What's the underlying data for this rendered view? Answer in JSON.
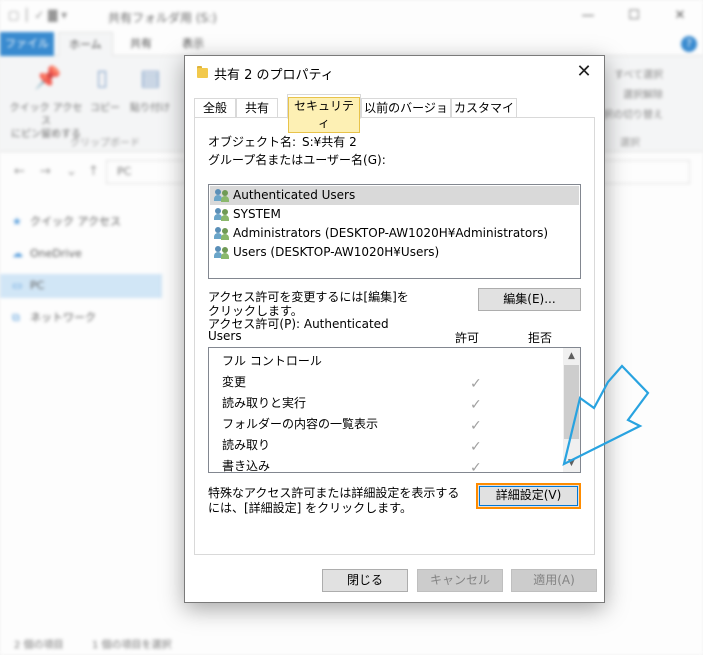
{
  "background": {
    "window_title": "共有フォルダ用 (S:)",
    "ribbon_tabs": [
      "ファイル",
      "ホーム",
      "共有",
      "表示"
    ],
    "ribbon_items": [
      "クイック アクセス\nにピン留めする",
      "コピー",
      "貼り付け"
    ],
    "ribbon_group_label": "クリップボード",
    "ribbon_right_items": [
      "すべて選択",
      "選択解除",
      "選択の切り替え"
    ],
    "ribbon_right_group": "選択",
    "address_path": "PC",
    "nav_items": [
      "クイック アクセス",
      "OneDrive",
      "PC",
      "ネットワーク"
    ],
    "status_left": "2 個の項目",
    "status_mid": "1 個の項目を選択"
  },
  "dialog": {
    "title": "共有 2 のプロパティ",
    "tabs": [
      "全般",
      "共有",
      "セキュリティ",
      "以前のバージョン",
      "カスタマイズ"
    ],
    "object_name_label": "オブジェクト名:",
    "object_name_value": "S:¥共有 2",
    "group_label": "グループ名またはユーザー名(G):",
    "users": [
      "Authenticated Users",
      "SYSTEM",
      "Administrators (DESKTOP-AW1020H¥Administrators)",
      "Users (DESKTOP-AW1020H¥Users)"
    ],
    "change_hint_line1": "アクセス許可を変更するには[編集]を",
    "change_hint_line2": "クリックします。",
    "edit_button": "編集(E)...",
    "perm_label_line1": "アクセス許可(P): Authenticated",
    "perm_label_line2": "Users",
    "allow_header": "許可",
    "deny_header": "拒否",
    "permissions": [
      "フル コントロール",
      "変更",
      "読み取りと実行",
      "フォルダーの内容の一覧表示",
      "読み取り",
      "書き込み"
    ],
    "advanced_hint_line1": "特殊なアクセス許可または詳細設定を表示する",
    "advanced_hint_line2": "には、[詳細設定] をクリックします。",
    "advanced_button": "詳細設定(V)",
    "close_button": "閉じる",
    "cancel_button": "キャンセル",
    "apply_button": "適用(A)"
  },
  "colors": {
    "accent_blue": "#0078d7",
    "focus_orange": "#ff8c00",
    "arrow_annotation": "#29a3e0",
    "selected_tab_highlight": "#fdf0b4"
  }
}
